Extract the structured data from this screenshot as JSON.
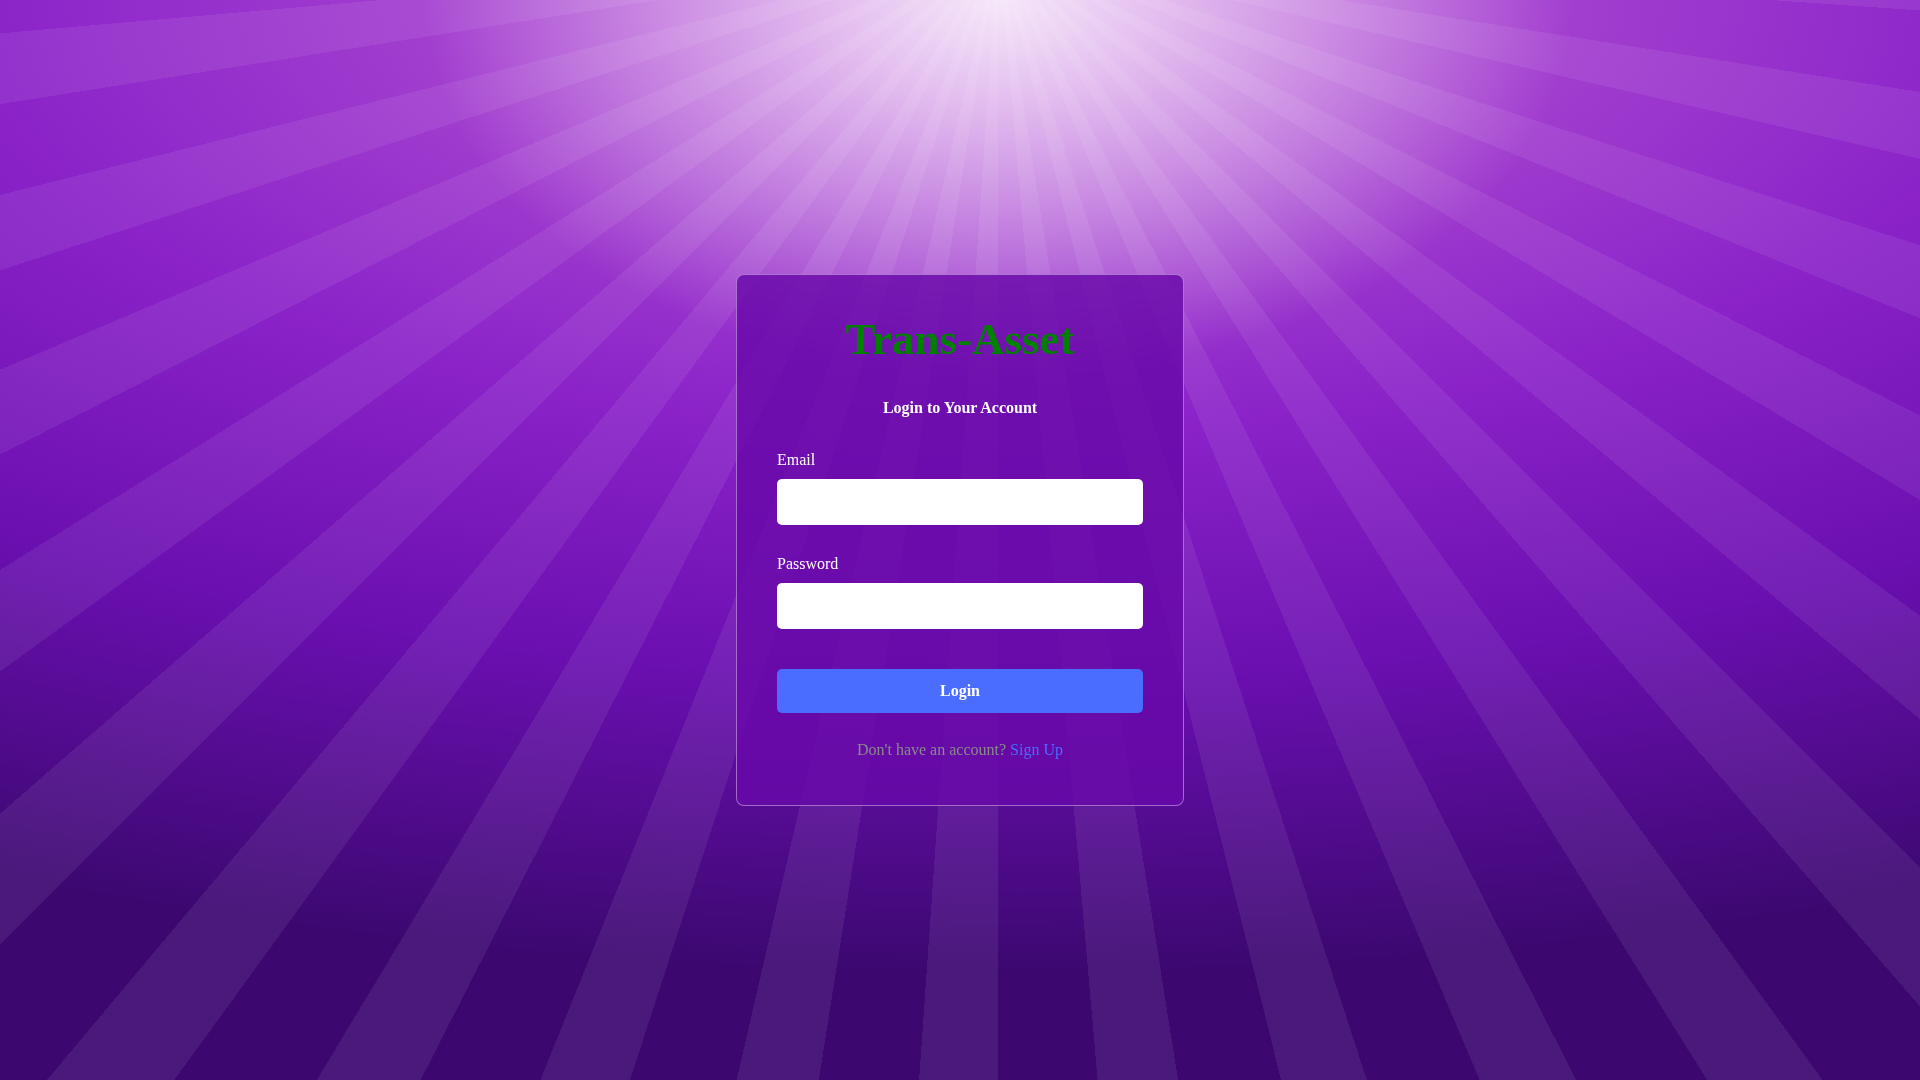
{
  "brand": {
    "title": "Trans-Asset"
  },
  "form": {
    "heading": "Login to Your Account",
    "fields": [
      {
        "label": "Email"
      },
      {
        "label": "Password"
      }
    ],
    "submit": "Login"
  },
  "signup": {
    "prompt": "Don't have an account?",
    "link": "Sign Up"
  }
}
